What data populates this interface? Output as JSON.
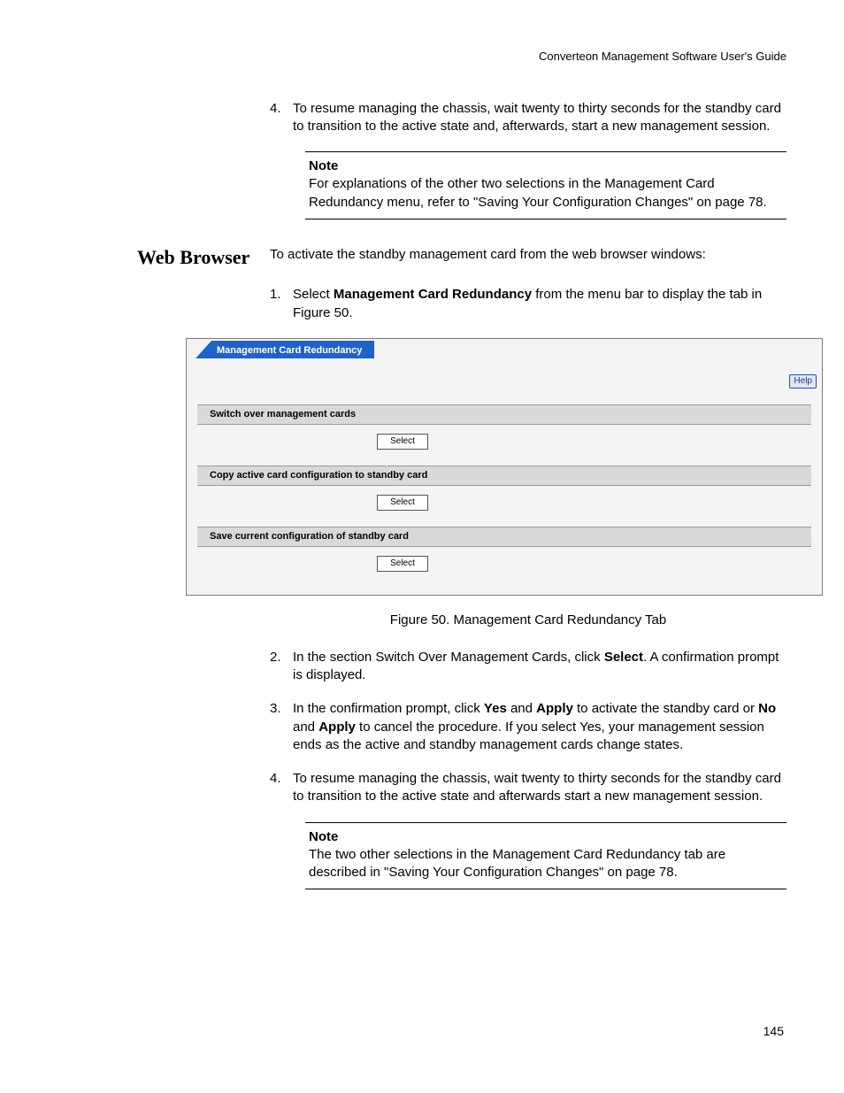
{
  "header": "Converteon Management Software User's Guide",
  "top_item": {
    "num": "4.",
    "text": "To resume managing the chassis, wait twenty to thirty seconds for the standby card to transition to the active state and, afterwards, start a new management session."
  },
  "note1": {
    "title": "Note",
    "text": "For explanations of the other two selections in the Management Card Redundancy menu, refer to \"Saving Your Configuration Changes\" on page 78."
  },
  "section_label": "Web Browser",
  "section_intro": "To activate the standby management card from the web browser windows:",
  "step1": {
    "num": "1.",
    "prefix": "Select ",
    "bold": "Management Card Redundancy",
    "suffix": " from the menu bar to display the tab in Figure 50."
  },
  "ui": {
    "tab_title": "Management Card Redundancy",
    "help_label": "Help",
    "sections": [
      {
        "header": "Switch over management cards",
        "button": "Select"
      },
      {
        "header": "Copy active card configuration to standby card",
        "button": "Select"
      },
      {
        "header": "Save current configuration of standby card",
        "button": "Select"
      }
    ]
  },
  "figure_caption": "Figure 50. Management Card Redundancy Tab",
  "step2": {
    "num": "2.",
    "prefix": "In the section Switch Over Management Cards, click ",
    "bold": "Select",
    "suffix": ". A confirmation prompt is displayed."
  },
  "step3": {
    "num": "3.",
    "p1": "In the confirmation prompt, click ",
    "b1": "Yes",
    "p2": " and ",
    "b2": "Apply",
    "p3": " to activate the standby card or ",
    "b3": "No",
    "p4": " and ",
    "b4": "Apply",
    "p5": " to cancel the procedure. If you select Yes, your management session ends as the active and standby management cards change states."
  },
  "step4": {
    "num": "4.",
    "text": "To resume managing the chassis, wait twenty to thirty seconds for the standby card to transition to the active state and afterwards start a new management session."
  },
  "note2": {
    "title": "Note",
    "text": "The two other selections in the Management Card Redundancy tab are described in \"Saving Your Configuration Changes\" on page 78."
  },
  "page_number": "145"
}
